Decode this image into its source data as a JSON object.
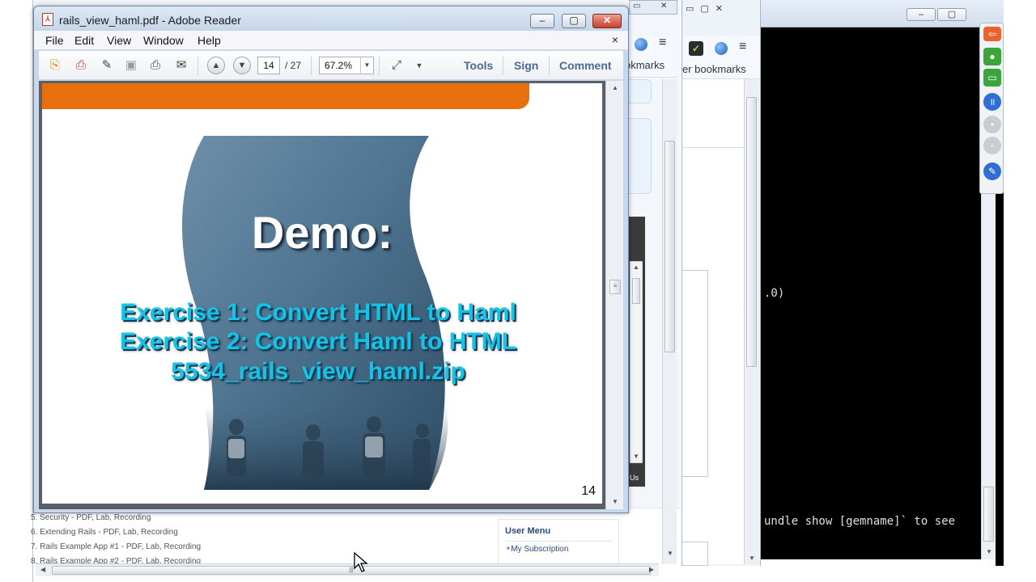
{
  "reader": {
    "title": "rails_view_haml.pdf - Adobe Reader",
    "menu": [
      "File",
      "Edit",
      "View",
      "Window",
      "Help"
    ],
    "page_current": "14",
    "page_total": "/ 27",
    "zoom": "67.2%",
    "tools_label": "Tools",
    "sign_label": "Sign",
    "comment_label": "Comment"
  },
  "slide": {
    "heading": "Demo:",
    "lines": [
      "Exercise 1: Convert HTML to Haml",
      "Exercise 2: Convert Haml to HTML",
      "5534_rails_view_haml.zip"
    ],
    "page_number": "14",
    "accent_color": "#e86f0e",
    "text_color": "#13c4e6"
  },
  "browser_back": {
    "bookmarks_fragment": "okmarks",
    "dark_tab_fragment": "Us",
    "course_items": [
      "5.  Security - PDF, Lab, Recording",
      "6.  Extending Rails - PDF, Lab, Recording",
      "7.  Rails Example App #1 - PDF, Lab, Recording",
      "8.  Rails Example App #2 - PDF, Lab, Recording"
    ],
    "user_menu_title": "User Menu",
    "user_menu_item": "My Subscription"
  },
  "browser2": {
    "bookmarks_fragment": "er bookmarks"
  },
  "terminal": {
    "line1": ".0)",
    "line2": "undle show [gemname]` to see"
  }
}
